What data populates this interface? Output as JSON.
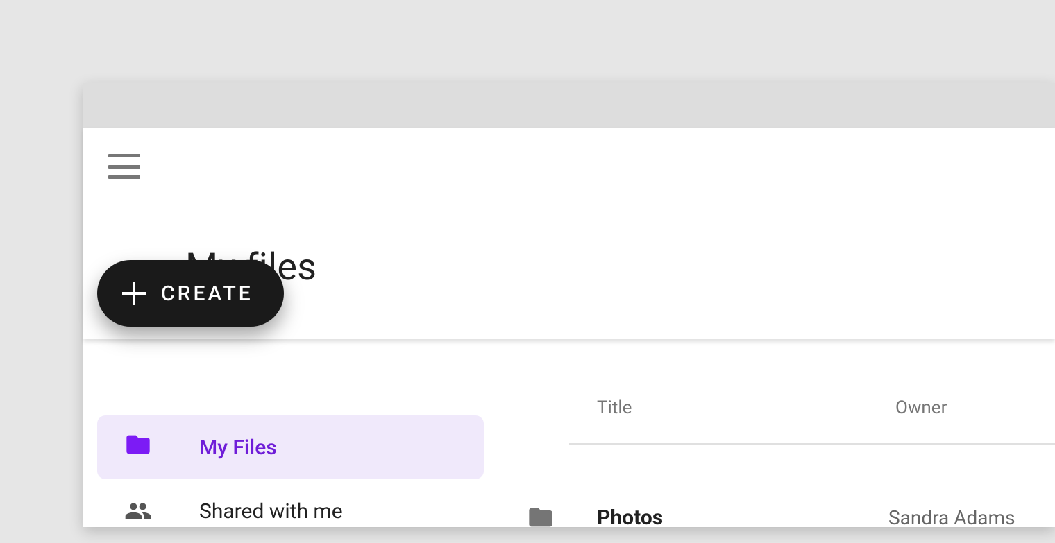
{
  "colors": {
    "accent": "#7c1bf5",
    "fab_bg": "#1a1a1a",
    "nav_active_bg": "#f0e9fb"
  },
  "header": {
    "title": "My files"
  },
  "fab": {
    "label": "CREATE",
    "icon": "plus-icon"
  },
  "sidebar": {
    "items": [
      {
        "label": "My Files",
        "icon": "folder-icon",
        "active": true
      },
      {
        "label": "Shared with me",
        "icon": "people-icon",
        "active": false
      }
    ]
  },
  "table": {
    "columns": [
      {
        "key": "title",
        "label": "Title"
      },
      {
        "key": "owner",
        "label": "Owner"
      }
    ],
    "rows": [
      {
        "title": "Photos",
        "owner": "Sandra Adams",
        "icon": "folder-icon"
      }
    ]
  }
}
